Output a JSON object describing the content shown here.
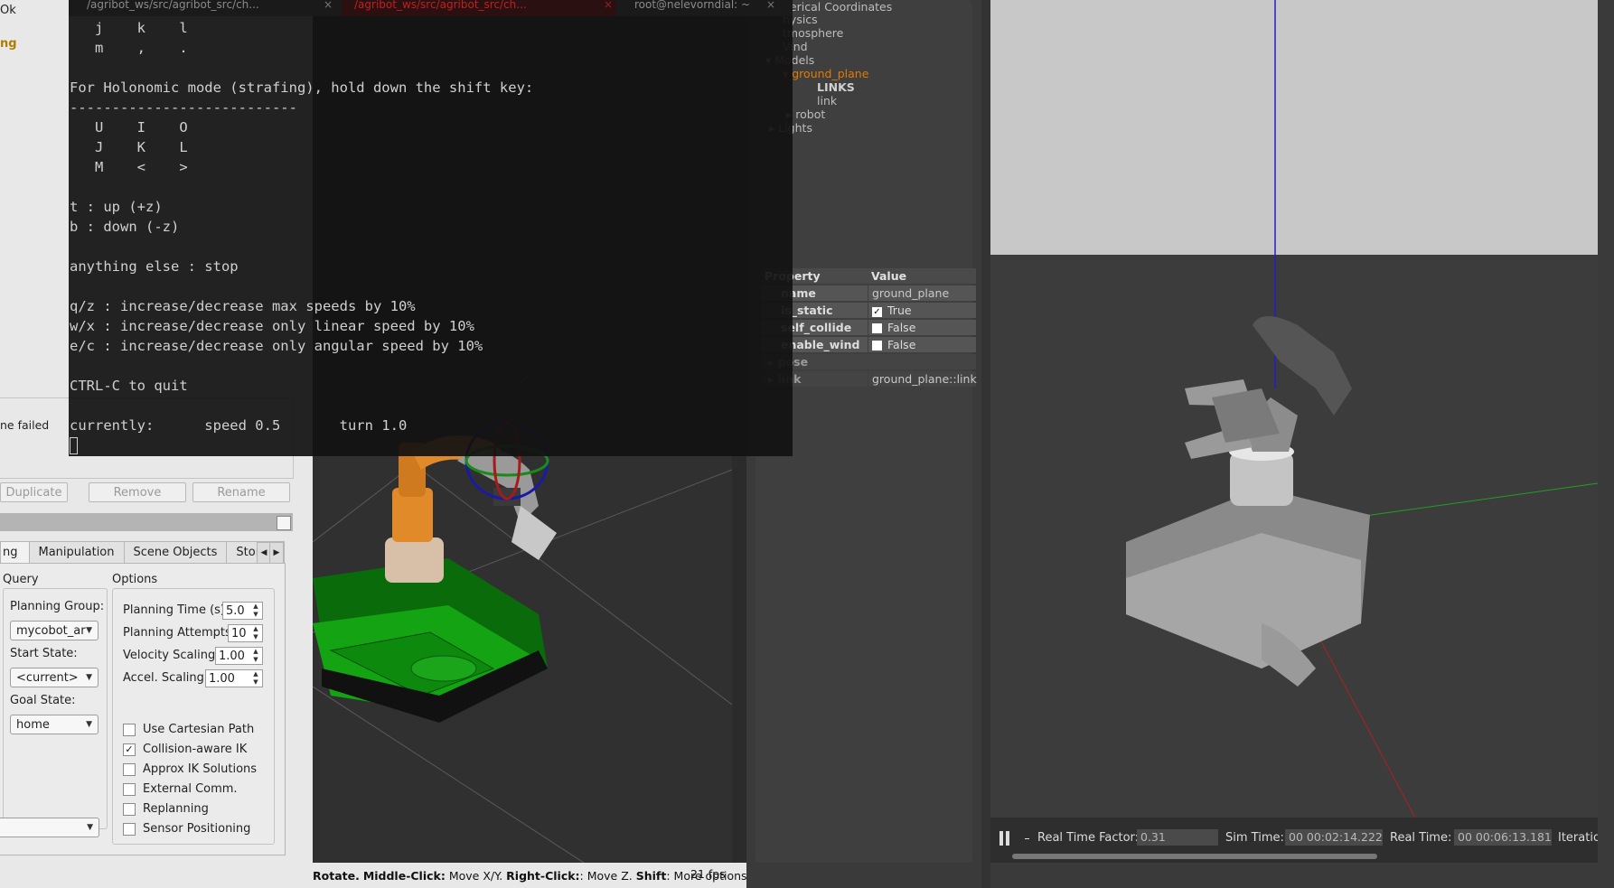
{
  "rviz_left": {
    "top_status_ok": "Ok",
    "top_status_warn": "ng",
    "status_failed": "ne failed",
    "buttons": {
      "duplicate": "Duplicate",
      "remove": "Remove",
      "rename": "Rename"
    },
    "tabs": [
      "ng",
      "Manipulation",
      "Scene Objects",
      "Stored"
    ],
    "query_header": "Query",
    "options_header": "Options",
    "planning_group_label": "Planning Group:",
    "planning_group_value": "mycobot_ar",
    "start_state_label": "Start State:",
    "start_state_value": "<current>",
    "goal_state_label": "Goal State:",
    "goal_state_value": "home",
    "planning_time_label": "Planning Time (s):",
    "planning_time_value": "5.0",
    "planning_attempts_label": "Planning Attempts:",
    "planning_attempts_value": "10",
    "velocity_scaling_label": "Velocity Scaling:",
    "velocity_scaling_value": "1.00",
    "accel_scaling_label": "Accel. Scaling:",
    "accel_scaling_value": "1.00",
    "checkboxes": [
      {
        "label": "Use Cartesian Path",
        "checked": false
      },
      {
        "label": "Collision-aware IK",
        "checked": true
      },
      {
        "label": "Approx IK Solutions",
        "checked": false
      },
      {
        "label": "External Comm.",
        "checked": false
      },
      {
        "label": "Replanning",
        "checked": false
      },
      {
        "label": "Sensor Positioning",
        "checked": false
      }
    ]
  },
  "rviz_status": {
    "rotate": "Rotate.",
    "middle_click": "Middle-Click:",
    "move_xy": " Move X/Y. ",
    "right_click": "Right-Click:",
    "move_z": ": Move Z. ",
    "shift": "Shift",
    "more": ": More options.",
    "fps": "21 fps"
  },
  "terminal": {
    "tabs": [
      "/agribot_ws/src/agribot_src/ch...",
      "/agribot_ws/src/agribot_src/ch...",
      "root@nelevorndial: ~"
    ],
    "lines": [
      "   j    k    l",
      "   m    ,    .",
      "",
      "For Holonomic mode (strafing), hold down the shift key:",
      "---------------------------",
      "   U    I    O",
      "   J    K    L",
      "   M    <    >",
      "",
      "t : up (+z)",
      "b : down (-z)",
      "",
      "anything else : stop",
      "",
      "q/z : increase/decrease max speeds by 10%",
      "w/x : increase/decrease only linear speed by 10%",
      "e/c : increase/decrease only angular speed by 10%",
      "",
      "CTRL-C to quit",
      "",
      "currently:      speed 0.5       turn 1.0"
    ]
  },
  "gazebo_tree": {
    "items": [
      "herical Coordinates",
      "hysics",
      "tmosphere",
      "Vind",
      "Models",
      "ground_plane",
      "LINKS",
      "link",
      "robot",
      "Lights"
    ]
  },
  "properties": {
    "header_property": "Property",
    "header_value": "Value",
    "rows": [
      {
        "key": "name",
        "value": "ground_plane"
      },
      {
        "key": "is_static",
        "value": "True",
        "checked": true
      },
      {
        "key": "self_collide",
        "value": "False",
        "checked": false
      },
      {
        "key": "enable_wind",
        "value": "False",
        "checked": false
      },
      {
        "key": "pose",
        "value": ""
      },
      {
        "key": "link",
        "value": "ground_plane::link"
      }
    ]
  },
  "gazebo_bar": {
    "rtf_label": "Real Time Factor:",
    "rtf_value": "0.31",
    "sim_label": "Sim Time:",
    "sim_value": "00 00:02:14.222",
    "real_label": "Real Time:",
    "real_value": "00 00:06:13.181",
    "iter_label": "Iteratio"
  }
}
